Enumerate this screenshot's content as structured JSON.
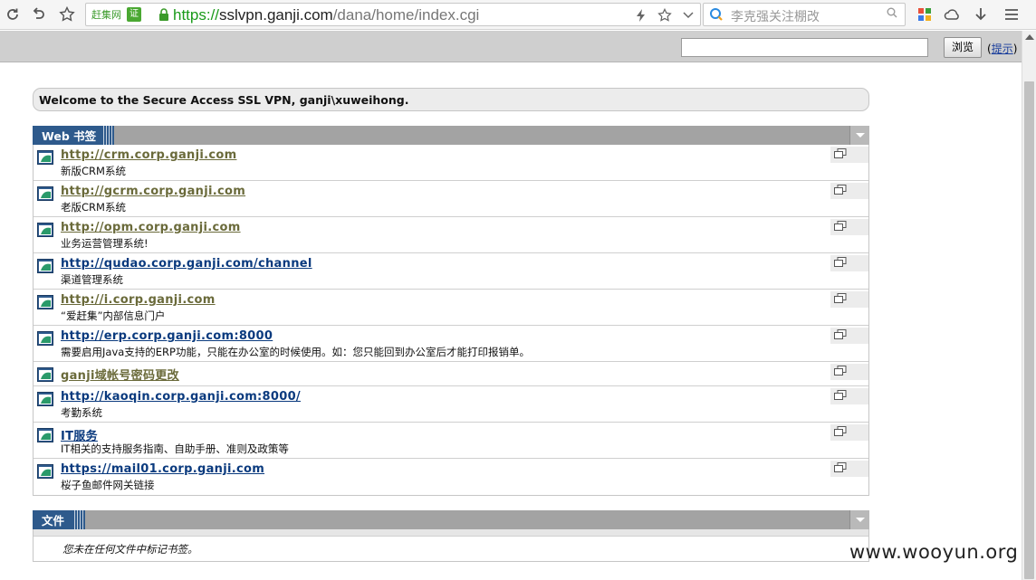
{
  "browser": {
    "site_badge": "赶集网",
    "cert_label": "证",
    "url": {
      "scheme": "https://",
      "host": "sslvpn.ganji.com",
      "path": "/dana/home/index.cgi"
    },
    "search_placeholder": "李克强关注棚改"
  },
  "strip": {
    "browse_label": "浏览",
    "hint_open": "(",
    "hint_link": "提示",
    "hint_close": ")"
  },
  "welcome": "Welcome to the Secure Access SSL VPN, ganji\\xuweihong.",
  "web_bookmarks": {
    "title": "Web 书签",
    "items": [
      {
        "url": "http://crm.corp.ganji.com ",
        "desc": "新版CRM系统",
        "visited": true
      },
      {
        "url": "http://gcrm.corp.ganji.com ",
        "desc": "老版CRM系统",
        "visited": true
      },
      {
        "url": "http://opm.corp.ganji.com ",
        "desc": "业务运营管理系统!",
        "visited": true
      },
      {
        "url": "http://qudao.corp.ganji.com/channel ",
        "desc": "渠道管理系统",
        "visited": false
      },
      {
        "url": "http://i.corp.ganji.com ",
        "desc": "“爱赶集”内部信息门户",
        "visited": true
      },
      {
        "url": "http://erp.corp.ganji.com:8000 ",
        "desc": "需要启用Java支持的ERP功能，只能在办公室的时候使用。如：您只能回到办公室后才能打印报销单。",
        "visited": false
      },
      {
        "url": "ganji域帐号密码更改 ",
        "desc": "",
        "visited": true
      },
      {
        "url": "http://kaoqin.corp.ganji.com:8000/ ",
        "desc": "考勤系统",
        "visited": false
      },
      {
        "url": "IT服务 ",
        "desc": "IT相关的支持服务指南、自助手册、准则及政策等",
        "visited": false
      },
      {
        "url": "https://mail01.corp.ganji.com ",
        "desc": "桜子鱼邮件网关链接",
        "visited": false
      }
    ]
  },
  "files": {
    "title": "文件",
    "empty_message": "您未在任何文件中标记书签。"
  },
  "watermark": "www.wooyun.org",
  "colors": {
    "panel_blue": "#2e5a8c",
    "header_gray": "#a3a3a3",
    "visited_link": "#6a6a3a",
    "link": "#0a3a7e"
  }
}
